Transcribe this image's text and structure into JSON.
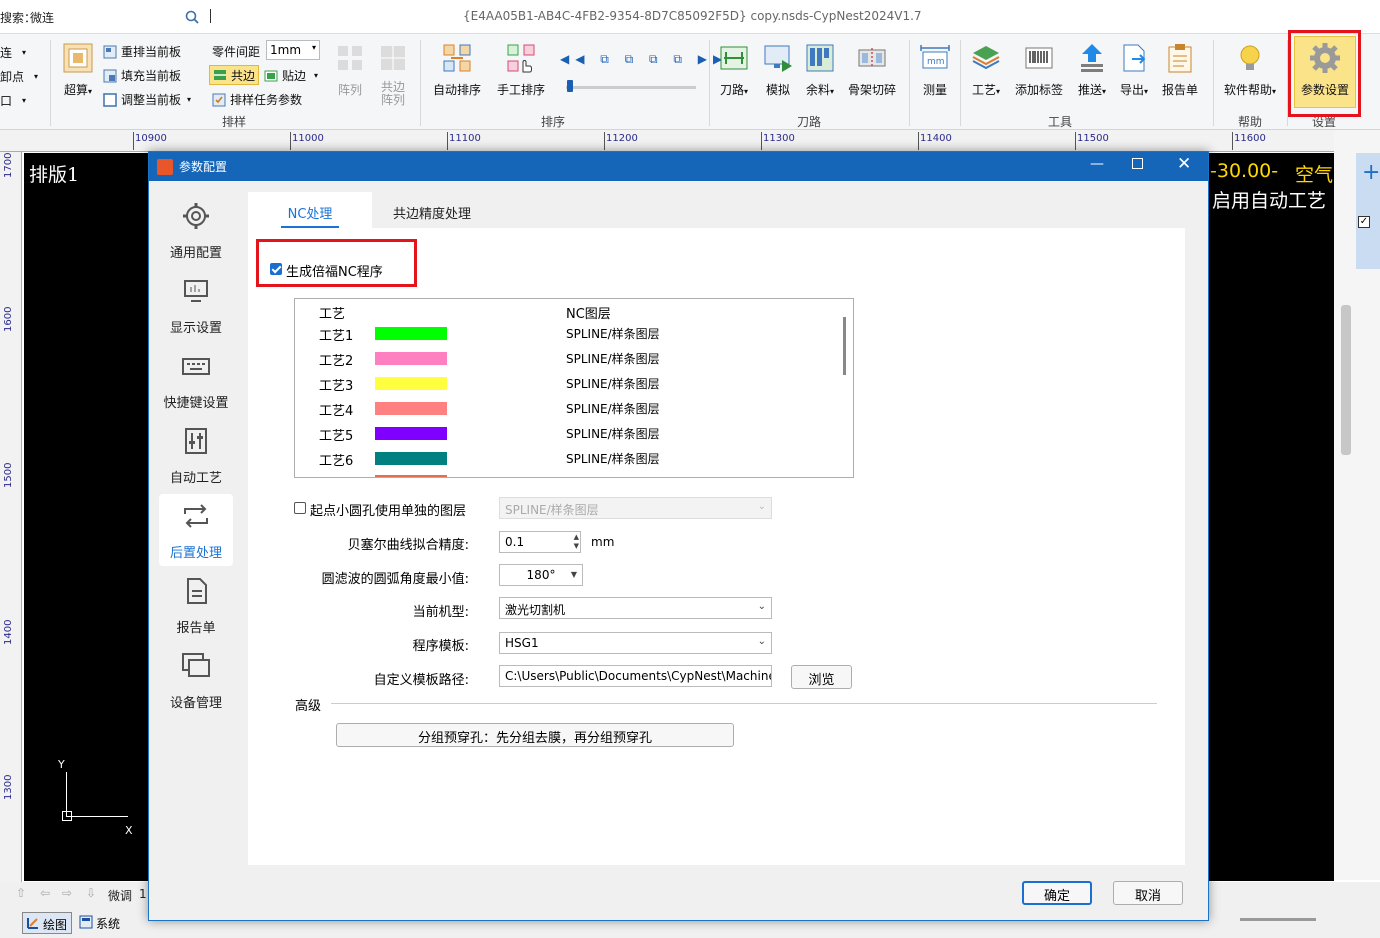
{
  "topbar": {
    "search_label": "搜索：",
    "search_value": "微连",
    "window_title": "{E4AA05B1-AB4C-4FB2-9354-8D7C85092F5D} copy.nsds-CypNest2024V1.7"
  },
  "ribbon": {
    "partial_items": [
      "连",
      "卸点",
      "口"
    ],
    "sort_group": {
      "label": "排样",
      "nest_button": "超算",
      "renest_current": "重排当前板",
      "fill_current": "填充当前板",
      "adjust_current": "调整当前板",
      "part_spacing_label": "零件间距",
      "part_spacing_value": "1mm",
      "common_edge": "共边",
      "stick_edge": "贴边",
      "task_params": "排样任务参数",
      "array": "阵列",
      "common_array": "共边阵列"
    },
    "order_group": {
      "label": "排序",
      "auto_sort": "自动排序",
      "manual_sort": "手工排序"
    },
    "toolpath_group": {
      "label": "刀路",
      "toolpath": "刀路",
      "simulate": "模拟",
      "remnant": "余料",
      "skeleton_cut": "骨架切碎"
    },
    "tools_group": {
      "label": "工具",
      "measure": "测量",
      "process": "工艺",
      "add_label": "添加标签",
      "push": "推送",
      "export": "导出",
      "report": "报告单"
    },
    "help_group": {
      "label": "帮助",
      "software_help": "软件帮助"
    },
    "settings_group": {
      "label": "设置",
      "param_settings": "参数设置"
    },
    "colors": {
      "highlight_border": "#e3141c",
      "highlight_fill": "#fbe38a"
    }
  },
  "ruler": {
    "h_ticks": [
      "10900",
      "11000",
      "11100",
      "11200",
      "11300",
      "11400",
      "11500",
      "11600"
    ],
    "v_ticks": [
      "1700",
      "1600",
      "1500",
      "1400",
      "1300"
    ]
  },
  "canvas": {
    "title": "排版1",
    "status_value": "-30.00-",
    "status_word": "空气",
    "status_line2": "启用自动工艺",
    "axis_y": "Y",
    "axis_x": "X"
  },
  "bottom": {
    "micro_label": "微调",
    "micro_value": "1",
    "tab_draw": "绘图",
    "tab_system": "系统"
  },
  "dialog": {
    "title": "参数配置",
    "sidebar": [
      {
        "label": "通用配置",
        "icon": "gear-icon"
      },
      {
        "label": "显示设置",
        "icon": "monitor-icon"
      },
      {
        "label": "快捷键设置",
        "icon": "keyboard-icon"
      },
      {
        "label": "自动工艺",
        "icon": "sliders-icon"
      },
      {
        "label": "后置处理",
        "icon": "loop-arrows-icon"
      },
      {
        "label": "报告单",
        "icon": "document-icon"
      },
      {
        "label": "设备管理",
        "icon": "device-icon"
      }
    ],
    "active_sidebar": "后置处理",
    "tabs": [
      "NC处理",
      "共边精度处理"
    ],
    "active_tab": "NC处理",
    "gen_beckhoff_nc": {
      "label": "生成倍福NC程序",
      "checked": true
    },
    "process_table": {
      "headers": [
        "工艺",
        "NC图层"
      ],
      "rows": [
        {
          "name": "工艺1",
          "color": "#00ff00",
          "layer": "SPLINE/样条图层"
        },
        {
          "name": "工艺2",
          "color": "#ff80c0",
          "layer": "SPLINE/样条图层"
        },
        {
          "name": "工艺3",
          "color": "#ffff40",
          "layer": "SPLINE/样条图层"
        },
        {
          "name": "工艺4",
          "color": "#ff8080",
          "layer": "SPLINE/样条图层"
        },
        {
          "name": "工艺5",
          "color": "#8000ff",
          "layer": "SPLINE/样条图层"
        },
        {
          "name": "工艺6",
          "color": "#008080",
          "layer": "SPLINE/样条图层"
        }
      ]
    },
    "small_hole_layer": {
      "label": "起点小圆孔使用单独的图层",
      "checked": false,
      "value": "SPLINE/样条图层"
    },
    "bezier_precision": {
      "label": "贝塞尔曲线拟合精度:",
      "value": "0.1",
      "unit": "mm"
    },
    "arc_filter": {
      "label": "圆滤波的圆弧角度最小值:",
      "value": "180°"
    },
    "machine_type": {
      "label": "当前机型:",
      "value": "激光切割机"
    },
    "program_template": {
      "label": "程序模板:",
      "value": "HSG1"
    },
    "custom_template_path": {
      "label": "自定义模板路径:",
      "value": "C:\\Users\\Public\\Documents\\CypNest\\Machine",
      "browse": "浏览"
    },
    "advanced": {
      "label": "高级",
      "group_button": "分组预穿孔：先分组去膜，再分组预穿孔"
    },
    "ok": "确定",
    "cancel": "取消"
  }
}
